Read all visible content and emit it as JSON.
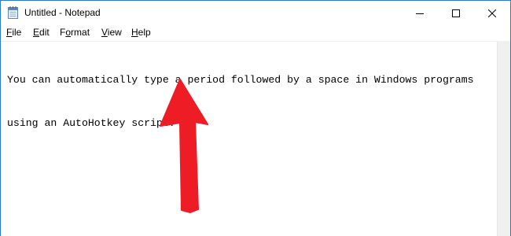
{
  "window": {
    "title": "Untitled - Notepad",
    "accent_color": "#2b79d6"
  },
  "title_buttons": {
    "minimize_icon": "minimize-icon",
    "maximize_icon": "maximize-icon",
    "close_icon": "close-icon"
  },
  "menu": {
    "items": [
      {
        "label": "File",
        "mnemonic": "F"
      },
      {
        "label": "Edit",
        "mnemonic": "E"
      },
      {
        "label": "Format",
        "mnemonic": "o"
      },
      {
        "label": "View",
        "mnemonic": "V"
      },
      {
        "label": "Help",
        "mnemonic": "H"
      }
    ]
  },
  "editor": {
    "lines": [
      "You can automatically type a period followed by a space in Windows programs",
      "using an AutoHotkey script. "
    ]
  },
  "annotation": {
    "icon": "red-arrow-icon",
    "color": "#ee1c24"
  }
}
